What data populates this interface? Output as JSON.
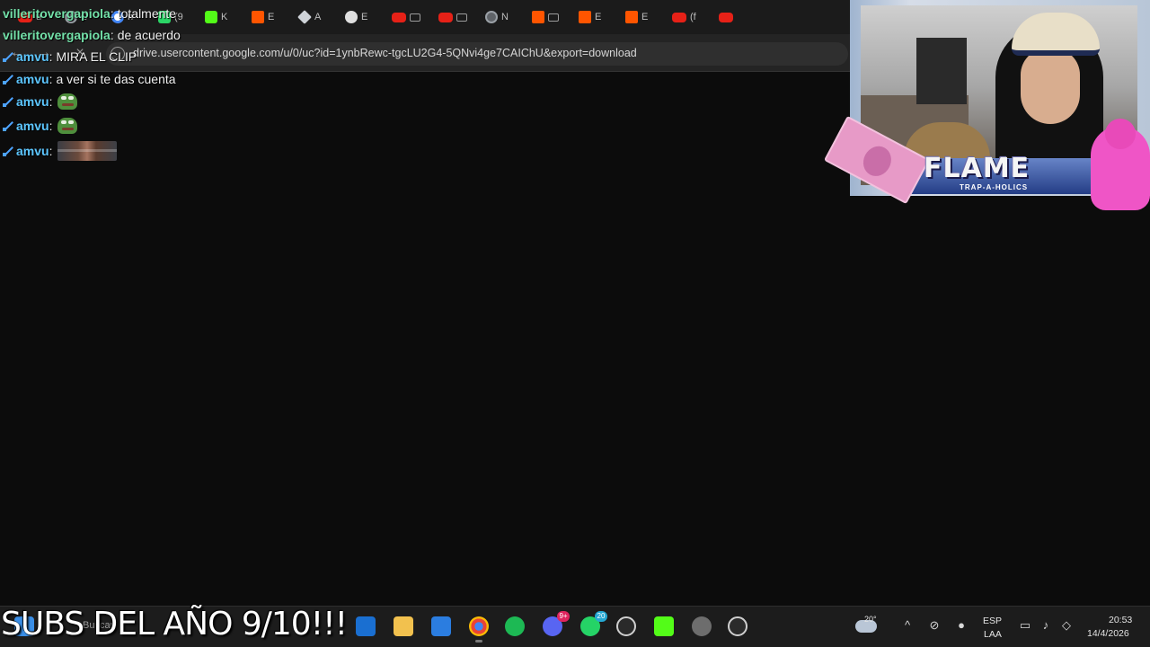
{
  "browser": {
    "tabs": [
      {
        "icon": "youtube-icon",
        "label": "u"
      },
      {
        "icon": "generic-site-icon",
        "label": "C"
      },
      {
        "icon": "google-icon",
        "label": "n"
      },
      {
        "icon": "whatsapp-icon",
        "label": "(9"
      },
      {
        "icon": "kick-icon",
        "label": "K"
      },
      {
        "icon": "soundcloud-icon",
        "label": "E"
      },
      {
        "icon": "diamond-icon",
        "label": "A"
      },
      {
        "icon": "disc-icon",
        "label": "E"
      },
      {
        "icon": "youtube-icon",
        "label": ""
      },
      {
        "icon": "youtube-icon",
        "label": ""
      },
      {
        "icon": "chrome-icon",
        "label": "N"
      },
      {
        "icon": "soundcloud-icon",
        "label": ""
      },
      {
        "icon": "soundcloud-icon",
        "label": "E"
      },
      {
        "icon": "soundcloud-icon",
        "label": "E"
      },
      {
        "icon": "youtube-icon",
        "label": "(f"
      },
      {
        "icon": "youtube-icon",
        "label": ""
      }
    ],
    "url": "drive.usercontent.google.com/u/0/uc?id=1ynbRewc-tgcLU2G4-5QNvi4ge7CAIChU&export=download"
  },
  "chat": {
    "messages": [
      {
        "user": "villeritovergapiola",
        "text": "totalmente",
        "badge": false
      },
      {
        "user": "villeritovergapiola",
        "text": "de acuerdo",
        "badge": false
      },
      {
        "user": "amvu",
        "text": "MIRA EL CLIP",
        "badge": true
      },
      {
        "user": "amvu",
        "text": "a ver si te das cuenta",
        "badge": true
      },
      {
        "user": "amvu",
        "text": "",
        "badge": true,
        "emote": "pepe-emote"
      },
      {
        "user": "amvu",
        "text": "",
        "badge": true,
        "emote": "pepe-emote"
      },
      {
        "user": "amvu",
        "text": "",
        "badge": true,
        "emote": "photo-emote"
      }
    ]
  },
  "overlay": {
    "brand_title": "FLAME",
    "brand_subtitle": "TRAP-A-HOLICS"
  },
  "stream_caption": "SUBS DEL AÑO 9/10!!!",
  "taskbar": {
    "search_placeholder": "Buscar",
    "pinned": [
      {
        "icon": "outlook-icon",
        "badge": ""
      },
      {
        "icon": "file-explorer-icon",
        "badge": ""
      },
      {
        "icon": "microsoft-store-icon",
        "badge": ""
      },
      {
        "icon": "chrome-icon",
        "badge": ""
      },
      {
        "icon": "spotify-icon",
        "badge": ""
      },
      {
        "icon": "discord-icon",
        "badge": "9+"
      },
      {
        "icon": "whatsapp-icon",
        "badge": "20"
      },
      {
        "icon": "g-hub-icon",
        "badge": ""
      },
      {
        "icon": "kick-icon",
        "badge": ""
      },
      {
        "icon": "settings-icon",
        "badge": ""
      },
      {
        "icon": "obs-icon",
        "badge": ""
      }
    ],
    "weather_temp": "20°",
    "language": "ESP",
    "layout": "LAA",
    "time": "20:53",
    "date": "14/4/2026"
  },
  "colors": {
    "chat_user_green": "#72e0a8",
    "chat_user_blue": "#5cc6ff",
    "background": "#0c0c0c"
  }
}
